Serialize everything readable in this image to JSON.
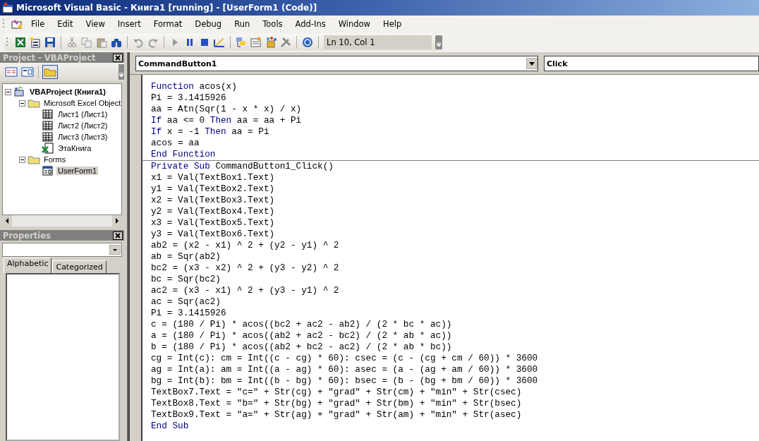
{
  "window": {
    "title": "Microsoft Visual Basic - Книга1 [running] - [UserForm1 (Code)]"
  },
  "menu": [
    "File",
    "Edit",
    "View",
    "Insert",
    "Format",
    "Debug",
    "Run",
    "Tools",
    "Add-Ins",
    "Window",
    "Help"
  ],
  "toolbar": {
    "position": "Ln 10, Col 1"
  },
  "project": {
    "title": "Project - VBAProject",
    "tree": [
      {
        "label": "VBAProject (Книга1)",
        "kind": "project",
        "expanded": true,
        "selected": false,
        "children": [
          {
            "label": "Microsoft Excel Object",
            "kind": "folder",
            "expanded": true,
            "selected": false,
            "children": [
              {
                "label": "Лист1 (Лист1)",
                "kind": "sheet",
                "selected": false
              },
              {
                "label": "Лист2 (Лист2)",
                "kind": "sheet",
                "selected": false
              },
              {
                "label": "Лист3 (Лист3)",
                "kind": "sheet",
                "selected": false
              },
              {
                "label": "ЭтаКнига",
                "kind": "workbook",
                "selected": false
              }
            ]
          },
          {
            "label": "Forms",
            "kind": "folder",
            "expanded": true,
            "selected": false,
            "children": [
              {
                "label": "UserForm1",
                "kind": "form",
                "selected": true
              }
            ]
          }
        ]
      }
    ]
  },
  "properties": {
    "title": "Properties",
    "tabs": [
      {
        "label": "Alphabetic",
        "selected": true
      },
      {
        "label": "Categorized",
        "selected": false
      }
    ]
  },
  "code": {
    "object": "CommandButton1",
    "procedure": "Click",
    "procedures": [
      {
        "lines": [
          [
            {
              "text": "Function",
              "kind": "keyword"
            },
            {
              "text": " acos(x)",
              "kind": "plain"
            }
          ],
          [
            {
              "text": "Pi = 3.1415926",
              "kind": "plain"
            }
          ],
          [
            {
              "text": "aa = Atn(Sqr(1 - x * x) / x)",
              "kind": "plain"
            }
          ],
          [
            {
              "text": "If",
              "kind": "keyword"
            },
            {
              "text": " aa <= 0 ",
              "kind": "plain"
            },
            {
              "text": "Then",
              "kind": "keyword"
            },
            {
              "text": " aa = aa + Pi",
              "kind": "plain"
            }
          ],
          [
            {
              "text": "If",
              "kind": "keyword"
            },
            {
              "text": " x = -1 ",
              "kind": "plain"
            },
            {
              "text": "Then",
              "kind": "keyword"
            },
            {
              "text": " aa = Pi",
              "kind": "plain"
            }
          ],
          [
            {
              "text": "acos = aa",
              "kind": "plain"
            }
          ],
          [
            {
              "text": "End Function",
              "kind": "keyword"
            }
          ]
        ]
      },
      {
        "lines": [
          [
            {
              "text": "Private Sub",
              "kind": "keyword"
            },
            {
              "text": " CommandButton1_Click()",
              "kind": "plain"
            }
          ],
          [
            {
              "text": "x1 = Val(TextBox1.Text)",
              "kind": "plain"
            }
          ],
          [
            {
              "text": "y1 = Val(TextBox2.Text)",
              "kind": "plain"
            }
          ],
          [
            {
              "text": "x2 = Val(TextBox3.Text)",
              "kind": "plain"
            }
          ],
          [
            {
              "text": "y2 = Val(TextBox4.Text)",
              "kind": "plain"
            }
          ],
          [
            {
              "text": "x3 = Val(TextBox5.Text)",
              "kind": "plain"
            }
          ],
          [
            {
              "text": "y3 = Val(TextBox6.Text)",
              "kind": "plain"
            }
          ],
          [
            {
              "text": "ab2 = (x2 - x1) ^ 2 + (y2 - y1) ^ 2",
              "kind": "plain"
            }
          ],
          [
            {
              "text": "ab = Sqr(ab2)",
              "kind": "plain"
            }
          ],
          [
            {
              "text": "bc2 = (x3 - x2) ^ 2 + (y3 - y2) ^ 2",
              "kind": "plain"
            }
          ],
          [
            {
              "text": "bc = Sqr(bc2)",
              "kind": "plain"
            }
          ],
          [
            {
              "text": "ac2 = (x3 - x1) ^ 2 + (y3 - y1) ^ 2",
              "kind": "plain"
            }
          ],
          [
            {
              "text": "ac = Sqr(ac2)",
              "kind": "plain"
            }
          ],
          [
            {
              "text": "Pi = 3.1415926",
              "kind": "plain"
            }
          ],
          [
            {
              "text": "c = (180 / Pi) * acos((bc2 + ac2 - ab2) / (2 * bc * ac))",
              "kind": "plain"
            }
          ],
          [
            {
              "text": "a = (180 / Pi) * acos((ab2 + ac2 - bc2) / (2 * ab * ac))",
              "kind": "plain"
            }
          ],
          [
            {
              "text": "b = (180 / Pi) * acos((ab2 + bc2 - ac2) / (2 * ab * bc))",
              "kind": "plain"
            }
          ],
          [
            {
              "text": "cg = Int(c): cm = Int((c - cg) * 60): csec = (c - (cg + cm / 60)) * 3600",
              "kind": "plain"
            }
          ],
          [
            {
              "text": "ag = Int(a): am = Int((a - ag) * 60): asec = (a - (ag + am / 60)) * 3600",
              "kind": "plain"
            }
          ],
          [
            {
              "text": "bg = Int(b): bm = Int((b - bg) * 60): bsec = (b - (bg + bm / 60)) * 3600",
              "kind": "plain"
            }
          ],
          [
            {
              "text": "TextBox7.Text = \"c=\" + Str(cg) + \"grad\" + Str(cm) + \"min\" + Str(csec)",
              "kind": "plain"
            }
          ],
          [
            {
              "text": "TextBox8.Text = \"b=\" + Str(bg) + \"grad\" + Str(bm) + \"min\" + Str(bsec)",
              "kind": "plain"
            }
          ],
          [
            {
              "text": "TextBox9.Text = \"a=\" + Str(ag) + \"grad\" + Str(am) + \"min\" + Str(asec)",
              "kind": "plain"
            }
          ],
          [
            {
              "text": "End Sub",
              "kind": "keyword"
            }
          ]
        ]
      }
    ]
  }
}
